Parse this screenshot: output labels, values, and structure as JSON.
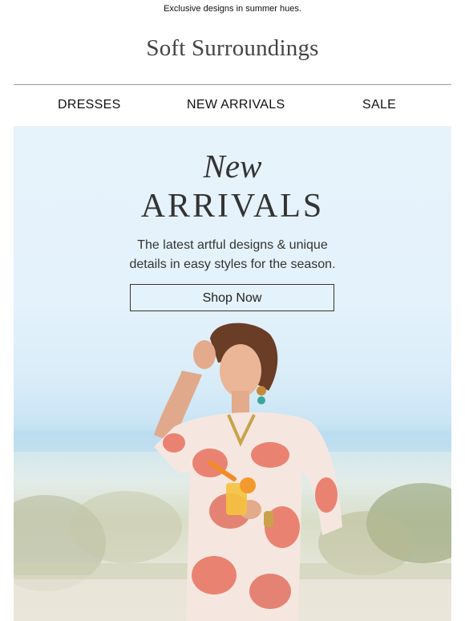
{
  "preheader": "Exclusive designs in summer hues.",
  "brand": {
    "logo_text": "Soft Surroundings"
  },
  "nav": {
    "items": [
      {
        "label": "DRESSES"
      },
      {
        "label": "NEW ARRIVALS"
      },
      {
        "label": "SALE"
      }
    ]
  },
  "hero": {
    "title_italic": "New",
    "title": "ARRIVALS",
    "subtitle_line1": "The latest artful designs & unique",
    "subtitle_line2": "details in easy styles for the season.",
    "cta_label": "Shop Now",
    "image_description_icon": "model-photo"
  },
  "colors": {
    "hero_background": "#e6f3fb",
    "dress_coral": "#e8705f",
    "text_dark": "#333333"
  }
}
